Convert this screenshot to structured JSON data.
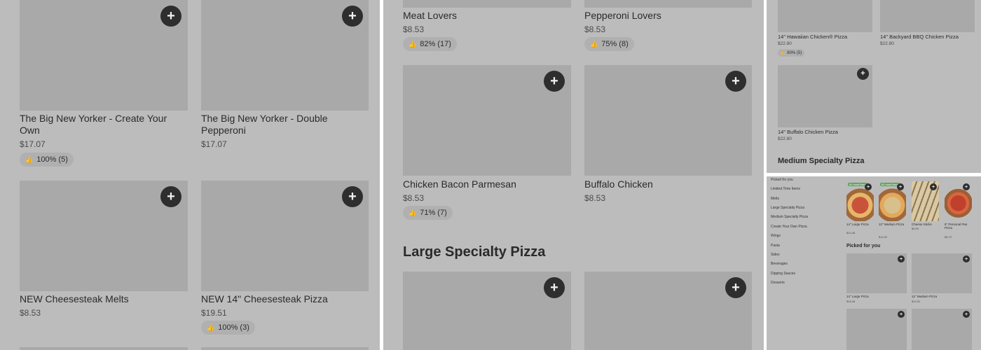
{
  "panel1": {
    "items": [
      {
        "name": "The Big New Yorker - Create Your Own",
        "price": "$17.07",
        "rating": "100% (5)"
      },
      {
        "name": "The Big New Yorker - Double Pepperoni",
        "price": "$17.07"
      },
      {
        "name": "NEW Cheesesteak Melts",
        "price": "$8.53"
      },
      {
        "name": "NEW 14\" Cheesesteak Pizza",
        "price": "$19.51",
        "rating": "100% (3)"
      }
    ]
  },
  "panel2": {
    "items": [
      {
        "name": "Meat Lovers",
        "price": "$8.53",
        "rating": "82% (17)"
      },
      {
        "name": "Pepperoni Lovers",
        "price": "$8.53",
        "rating": "75% (8)"
      },
      {
        "name": "Chicken Bacon Parmesan",
        "price": "$8.53",
        "rating": "71% (7)"
      },
      {
        "name": "Buffalo Chicken",
        "price": "$8.53"
      }
    ],
    "section_title": "Large Specialty Pizza"
  },
  "panel3": {
    "items": [
      {
        "name": "14\" Hawaiian Chicken® Pizza",
        "price": "$22.80",
        "rating": "80% (5)"
      },
      {
        "name": "14\" Backyard BBQ Chicken Pizza",
        "price": "$22.80"
      },
      {
        "name": "14\" Buffalo Chicken Pizza",
        "price": "$22.80"
      }
    ],
    "section_title": "Medium Specialty Pizza"
  },
  "panel4": {
    "nav": [
      "Picked for you",
      "Limited Time Items",
      "Melts",
      "Large Specialty Pizza",
      "Medium Specialty Pizza",
      "Create Your Own Pizza",
      "Wings",
      "Pasta",
      "Sides",
      "Beverages",
      "Dipping Sauces",
      "Desserts"
    ],
    "top_items": [
      {
        "name": "14\" Large Pizza",
        "price": "$13.48",
        "badge": "#1 most liked"
      },
      {
        "name": "12\" Medium Pizza",
        "price": "$14.02",
        "badge": "#2 most liked"
      },
      {
        "name": "Cheese Sticks",
        "price": "$9.50"
      },
      {
        "name": "6\" Personal Pan Pizza",
        "price": "$6.70"
      }
    ],
    "picked_title": "Picked for you",
    "picked_items": [
      {
        "name": "14\" Large Pizza",
        "price": "$16.48"
      },
      {
        "name": "12\" Medium Pizza",
        "price": "$14.02"
      }
    ]
  },
  "icons": {
    "plus": "+",
    "thumb": "👍"
  }
}
